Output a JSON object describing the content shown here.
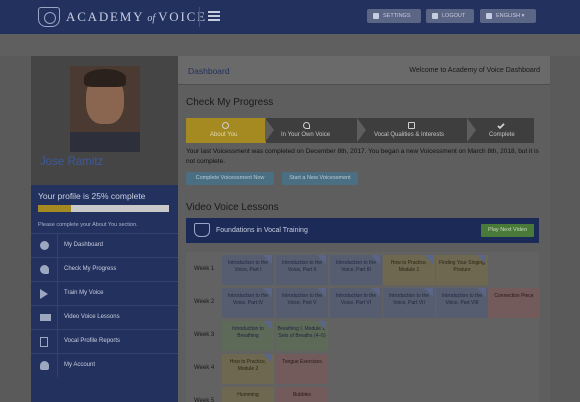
{
  "header": {
    "brand_main": "ACADEMY",
    "brand_of": "of",
    "brand_end": "VOICE",
    "buttons": [
      {
        "label": "SETTINGS",
        "icon": "gear-icon"
      },
      {
        "label": "LOGOUT",
        "icon": "lock-icon"
      },
      {
        "label": "ENGLISH ▾",
        "icon": "flag-icon"
      }
    ]
  },
  "sidebar": {
    "user_name": "Jose Ramitz",
    "completion_text": "Your profile is 25% complete",
    "completion_percent": 25,
    "completion_note": "Please complete your About You section.",
    "items": [
      {
        "label": "My Dashboard",
        "icon": "gear-icon"
      },
      {
        "label": "Check My Progress",
        "icon": "head-icon"
      },
      {
        "label": "Train My Voice",
        "icon": "play-icon"
      },
      {
        "label": "Video Voice Lessons",
        "icon": "video-camera-icon"
      },
      {
        "label": "Vocal Profile Reports",
        "icon": "document-icon"
      },
      {
        "label": "My Account",
        "icon": "user-icon"
      }
    ]
  },
  "dashboard": {
    "title": "Dashboard",
    "welcome": "Welcome to Academy of Voice Dashboard"
  },
  "progress_section": {
    "title": "Check My Progress",
    "steps": [
      {
        "label": "About You",
        "icon": "user-icon",
        "active": true
      },
      {
        "label": "In Your Own Voice",
        "icon": "head-icon",
        "active": false
      },
      {
        "label": "Vocal Qualities & Interests",
        "icon": "checkbox-icon",
        "active": false
      },
      {
        "label": "Complete",
        "icon": "check-icon",
        "active": false
      }
    ],
    "message": "Your last Voicessment was completed on December 8th, 2017. You began a new Voicessment on March 8th, 2018, but it is not complete.",
    "btn_complete": "Complete Voicessment Now",
    "btn_new": "Start a New Voicessment"
  },
  "lessons_section": {
    "title": "Video Voice Lessons",
    "course_title": "Foundations in Vocal Training",
    "play_button": "Play Next Video",
    "weeks": [
      {
        "label": "Week 1",
        "lessons": [
          {
            "title": "Introduction to the Voice, Part I",
            "color": "blue",
            "done": true
          },
          {
            "title": "Introduction to the Voice, Part II",
            "color": "blue",
            "done": true
          },
          {
            "title": "Introduction to the Voice, Part III",
            "color": "blue",
            "done": true
          },
          {
            "title": "How to Practice, Module 1",
            "color": "tan",
            "done": true
          },
          {
            "title": "Finding Your Singing Posture",
            "color": "tan",
            "done": true
          }
        ]
      },
      {
        "label": "Week 2",
        "lessons": [
          {
            "title": "Introduction to the Voice, Part IV",
            "color": "blue",
            "done": true
          },
          {
            "title": "Introduction to the Voice, Part V",
            "color": "blue",
            "done": true
          },
          {
            "title": "Introduction to the Voice, Part VI",
            "color": "blue",
            "done": true
          },
          {
            "title": "Introduction to the Voice, Part VII",
            "color": "blue",
            "done": true
          },
          {
            "title": "Introduction to the Voice, Part VIII",
            "color": "blue",
            "done": true
          },
          {
            "title": "Connection Piece",
            "color": "pink",
            "done": false
          }
        ]
      },
      {
        "label": "Week 3",
        "lessons": [
          {
            "title": "Introduction to Breathing",
            "color": "green",
            "done": true
          },
          {
            "title": "Breathing I, Module 1: Sets of Breaths (4–5)",
            "color": "green",
            "done": true
          }
        ]
      },
      {
        "label": "Week 4",
        "lessons": [
          {
            "title": "How to Practice, Module 2",
            "color": "tan",
            "done": true
          },
          {
            "title": "Tongue Exercises",
            "color": "pink",
            "done": false
          }
        ]
      },
      {
        "label": "Week 5",
        "lessons": [
          {
            "title": "Humming",
            "color": "tan",
            "done": false
          },
          {
            "title": "Bubbles",
            "color": "pink",
            "done": false
          }
        ]
      }
    ]
  },
  "colors": {
    "navy": "#22315e",
    "gold": "#a58a22",
    "overlay_gray": "#5e5e5e"
  }
}
